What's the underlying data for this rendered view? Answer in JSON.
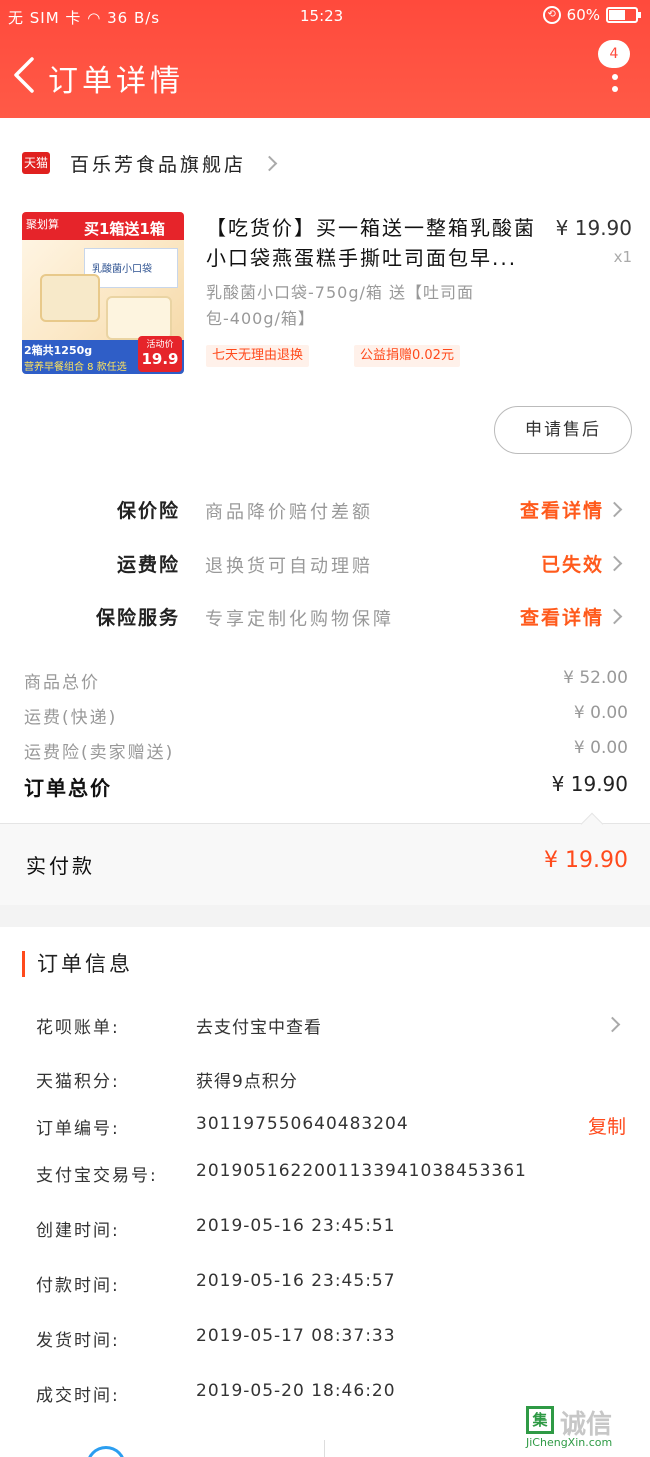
{
  "status_bar": {
    "carrier": "无 SIM 卡",
    "speed": "36 B/s",
    "time": "15:23",
    "battery": "60%"
  },
  "header": {
    "title": "订单详情",
    "badge_count": "4"
  },
  "shop": {
    "logo_text": "天猫",
    "name": "百乐芳食品旗舰店"
  },
  "product": {
    "image_text": {
      "brand": "聚划算",
      "slogan": "买1箱送1箱",
      "box_label": "乳酸菌小口袋",
      "pack": "2箱共1250g",
      "combo": "营养早餐组合 8 款任选",
      "price_label": "活动价",
      "price": "19.9"
    },
    "title": "【吃货价】买一箱送一整箱乳酸菌小口袋燕蛋糕手撕吐司面包早...",
    "sku": "乳酸菌小口袋-750g/箱 送【吐司面包-400g/箱】",
    "price": "¥ 19.90",
    "quantity": "x1",
    "tags": [
      "七天无理由退换",
      "公益捐赠0.02元"
    ]
  },
  "after_sale_button": "申请售后",
  "insurance": [
    {
      "label": "保价险",
      "desc": "商品降价赔付差额",
      "action": "查看详情"
    },
    {
      "label": "运费险",
      "desc": "退换货可自动理赔",
      "action": "已失效"
    },
    {
      "label": "保险服务",
      "desc": "专享定制化购物保障",
      "action": "查看详情"
    }
  ],
  "price_summary": [
    {
      "label": "商品总价",
      "value": "¥ 52.00"
    },
    {
      "label": "运费(快递)",
      "value": "¥ 0.00"
    },
    {
      "label": "运费险(卖家赠送)",
      "value": "¥ 0.00"
    },
    {
      "label": "订单总价",
      "value": "¥ 19.90"
    }
  ],
  "payment": {
    "label": "实付款",
    "value": "¥ 19.90"
  },
  "order_info": {
    "heading": "订单信息",
    "rows": [
      {
        "label": "花呗账单:",
        "value": "去支付宝中查看"
      },
      {
        "label": "天猫积分:",
        "value": "获得9点积分"
      },
      {
        "label": "订单编号:",
        "value": "301197550640483204",
        "action": "复制"
      },
      {
        "label": "支付宝交易号:",
        "value": "2019051622001133941038453361"
      },
      {
        "label": "创建时间:",
        "value": "2019-05-16 23:45:51"
      },
      {
        "label": "付款时间:",
        "value": "2019-05-16 23:45:57"
      },
      {
        "label": "发货时间:",
        "value": "2019-05-17 08:37:33"
      },
      {
        "label": "成交时间:",
        "value": "2019-05-20 18:46:20"
      }
    ]
  },
  "watermark": {
    "icon_text": "集",
    "text": "诚信",
    "url": "JiChengXin.com"
  },
  "colors": {
    "brand_red": "#ff4a3c",
    "accent_orange": "#ff5a1c"
  }
}
